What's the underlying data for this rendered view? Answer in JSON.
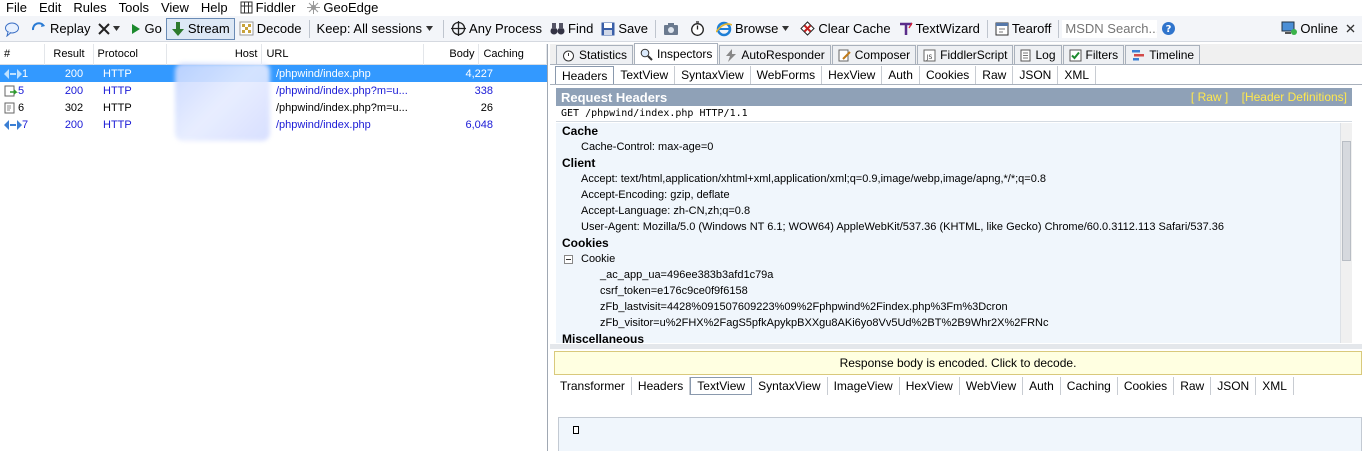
{
  "menu": [
    {
      "label": "File"
    },
    {
      "label": "Edit"
    },
    {
      "label": "Rules"
    },
    {
      "label": "Tools"
    },
    {
      "label": "View"
    },
    {
      "label": "Help"
    },
    {
      "label": "Fiddler",
      "icon": "fiddler-grid-icon"
    },
    {
      "label": "GeoEdge",
      "icon": "geoedge-icon"
    }
  ],
  "toolbar": {
    "replay": "Replay",
    "go": "Go",
    "stream": "Stream",
    "decode": "Decode",
    "keep": "Keep: All sessions",
    "process": "Any Process",
    "find": "Find",
    "save": "Save",
    "browse": "Browse",
    "clear_cache": "Clear Cache",
    "textwizard": "TextWizard",
    "tearoff": "Tearoff",
    "search_placeholder": "MSDN Search...",
    "online": "Online"
  },
  "sessions": {
    "columns": [
      "#",
      "Result",
      "Protocol",
      "Host",
      "URL",
      "Body",
      "Caching"
    ],
    "rows": [
      {
        "num": "1",
        "result": "200",
        "protocol": "HTTP",
        "host": "",
        "url": "/phpwind/index.php",
        "body": "4,227",
        "caching": "",
        "icon": "arrows-icon",
        "selected": true
      },
      {
        "num": "5",
        "result": "200",
        "protocol": "HTTP",
        "host": "",
        "url": "/phpwind/index.php?m=u...",
        "body": "338",
        "caching": "",
        "icon": "script-icon",
        "selected": false
      },
      {
        "num": "6",
        "result": "302",
        "protocol": "HTTP",
        "host": "",
        "url": "/phpwind/index.php?m=u...",
        "body": "26",
        "caching": "",
        "icon": "redirect-icon",
        "selected": false
      },
      {
        "num": "7",
        "result": "200",
        "protocol": "HTTP",
        "host": "",
        "url": "/phpwind/index.php",
        "body": "6,048",
        "caching": "",
        "icon": "arrows-icon",
        "selected": false
      }
    ]
  },
  "tabs_main": [
    "Statistics",
    "Inspectors",
    "AutoResponder",
    "Composer",
    "FiddlerScript",
    "Log",
    "Filters",
    "Timeline"
  ],
  "tabs_request": [
    "Headers",
    "TextView",
    "SyntaxView",
    "WebForms",
    "HexView",
    "Auth",
    "Cookies",
    "Raw",
    "JSON",
    "XML"
  ],
  "request": {
    "title": "Request Headers",
    "raw_link": "[ Raw ]",
    "defs_link": "[Header Definitions]",
    "line": "GET /phpwind/index.php HTTP/1.1",
    "groups": {
      "cache": {
        "label": "Cache",
        "items": [
          "Cache-Control: max-age=0"
        ]
      },
      "client": {
        "label": "Client",
        "items": [
          "Accept: text/html,application/xhtml+xml,application/xml;q=0.9,image/webp,image/apng,*/*;q=0.8",
          "Accept-Encoding: gzip, deflate",
          "Accept-Language: zh-CN,zh;q=0.8",
          "User-Agent: Mozilla/5.0 (Windows NT 6.1; WOW64) AppleWebKit/537.36 (KHTML, like Gecko) Chrome/60.0.3112.113 Safari/537.36"
        ]
      },
      "cookies": {
        "label": "Cookies",
        "cookie_label": "Cookie",
        "items": [
          "_ac_app_ua=496ee383b3afd1c79a",
          "csrf_token=e176c9ce0f9f6158",
          "zFb_lastvisit=4428%091507609223%09%2Fphpwind%2Findex.php%3Fm%3Dcron",
          "zFb_visitor=u%2FHX%2FagS5pfkApykpBXXgu8AKi6yo8Vv5Ud%2BT%2B9Whr2X%2FRNc"
        ]
      },
      "misc": {
        "label": "Miscellaneous"
      }
    }
  },
  "response": {
    "banner": "Response body is encoded. Click to decode.",
    "tabs": [
      "Transformer",
      "Headers",
      "TextView",
      "SyntaxView",
      "ImageView",
      "HexView",
      "WebView",
      "Auth",
      "Caching",
      "Cookies",
      "Raw",
      "JSON",
      "XML"
    ]
  }
}
